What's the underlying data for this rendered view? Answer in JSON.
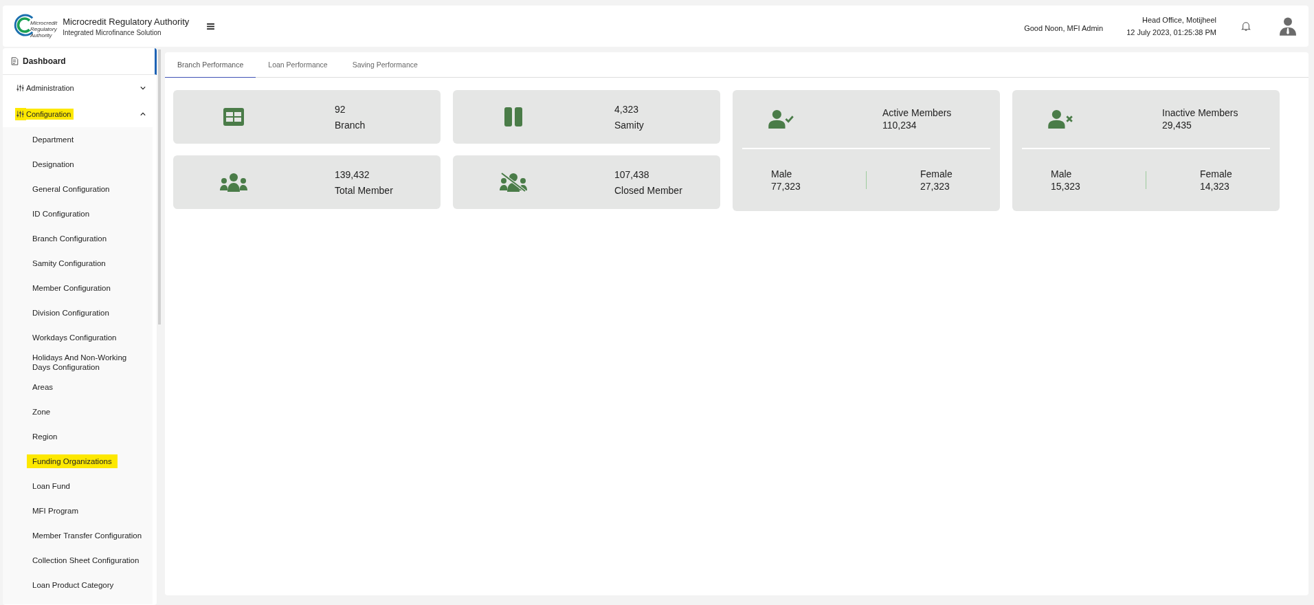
{
  "header": {
    "org_name": "Microcredit Regulatory Authority",
    "app_name": "Integrated Microfinance Solution",
    "logo_text": [
      "Microcredit",
      "Regulatory",
      "Authority"
    ],
    "greeting": "Good Noon, MFI Admin",
    "office": "Head Office, Motijheel",
    "datetime": "12 July 2023, 01:25:38 PM"
  },
  "sidebar": {
    "items": [
      {
        "label": "Dashboard",
        "kind": "link",
        "selected": true
      },
      {
        "label": "Administration",
        "kind": "group",
        "expanded": false,
        "highlighted": false
      },
      {
        "label": "Configuration",
        "kind": "group",
        "expanded": true,
        "highlighted": true,
        "children": [
          {
            "label": "Department",
            "highlighted": false
          },
          {
            "label": "Designation",
            "highlighted": false
          },
          {
            "label": "General Configuration",
            "highlighted": false
          },
          {
            "label": "ID Configuration",
            "highlighted": false
          },
          {
            "label": "Branch Configuration",
            "highlighted": false
          },
          {
            "label": "Samity Configuration",
            "highlighted": false
          },
          {
            "label": "Member Configuration",
            "highlighted": false
          },
          {
            "label": "Division Configuration",
            "highlighted": false
          },
          {
            "label": "Workdays Configuration",
            "highlighted": false
          },
          {
            "label": "Holidays And Non-Working Days Configuration",
            "highlighted": false
          },
          {
            "label": "Areas",
            "highlighted": false
          },
          {
            "label": "Zone",
            "highlighted": false
          },
          {
            "label": "Region",
            "highlighted": false
          },
          {
            "label": "Funding Organizations",
            "highlighted": true
          },
          {
            "label": "Loan Fund",
            "highlighted": false
          },
          {
            "label": "MFI Program",
            "highlighted": false
          },
          {
            "label": "Member Transfer Configuration",
            "highlighted": false
          },
          {
            "label": "Collection Sheet Configuration",
            "highlighted": false
          },
          {
            "label": "Loan Product Category",
            "highlighted": false
          }
        ]
      }
    ]
  },
  "tabs": [
    {
      "label": "Branch Performance",
      "selected": true
    },
    {
      "label": "Loan Performance",
      "selected": false
    },
    {
      "label": "Saving Performance",
      "selected": false
    }
  ],
  "summary_cards": [
    {
      "value": "92",
      "label": "Branch"
    },
    {
      "value": "4,323",
      "label": "Samity"
    },
    {
      "value": "139,432",
      "label": "Total Member"
    },
    {
      "value": "107,438",
      "label": "Closed Member"
    }
  ],
  "member_cards": [
    {
      "label": "Active Members",
      "value": "110,234",
      "left": {
        "label": "Male",
        "value": "77,323"
      },
      "right": {
        "label": "Female",
        "value": "27,323"
      }
    },
    {
      "label": "Inactive Members",
      "value": "29,435",
      "left": {
        "label": "Male",
        "value": "15,323"
      },
      "right": {
        "label": "Female",
        "value": "14,323"
      }
    }
  ]
}
